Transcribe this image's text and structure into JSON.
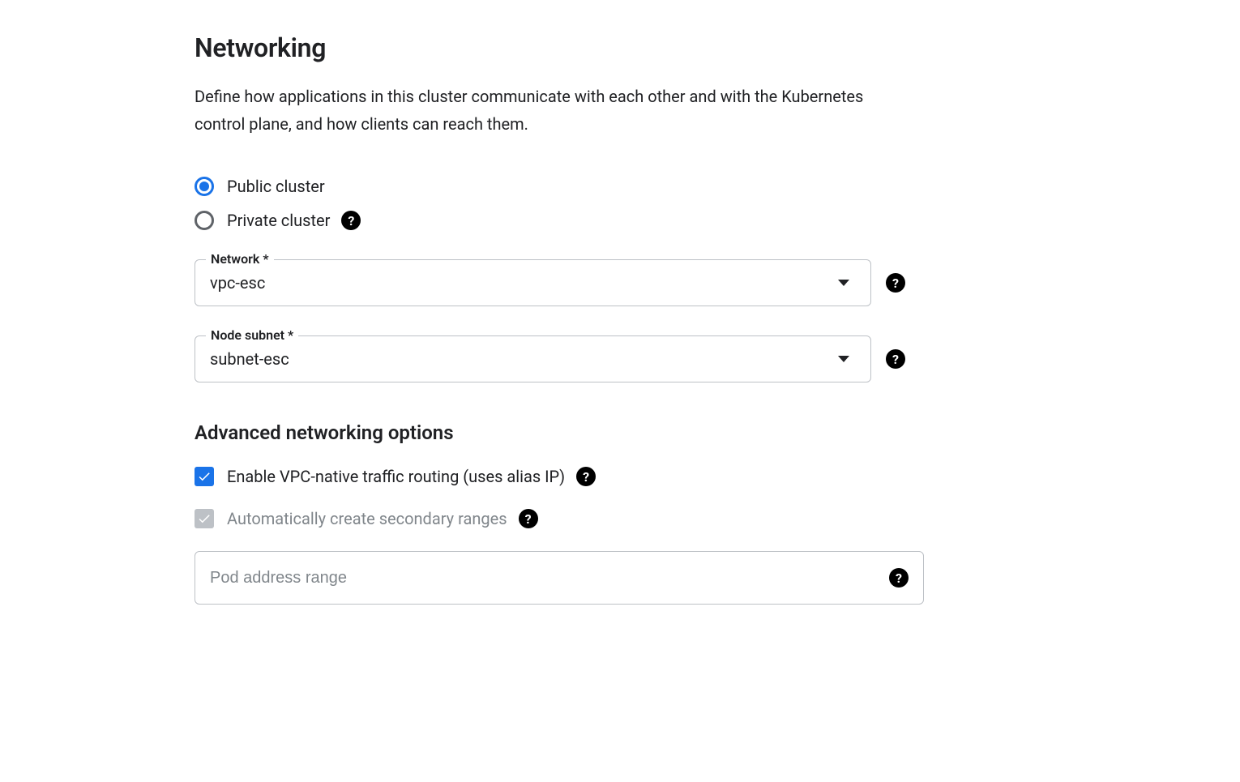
{
  "title": "Networking",
  "description": "Define how applications in this cluster communicate with each other and with the Kubernetes control plane, and how clients can reach them.",
  "radio": {
    "public_label": "Public cluster",
    "private_label": "Private cluster"
  },
  "network": {
    "label": "Network *",
    "value": "vpc-esc"
  },
  "node_subnet": {
    "label": "Node subnet *",
    "value": "subnet-esc"
  },
  "advanced_heading": "Advanced networking options",
  "vpc_native": {
    "label": "Enable VPC-native traffic routing (uses alias IP)"
  },
  "auto_secondary": {
    "label": "Automatically create secondary ranges"
  },
  "pod_range": {
    "placeholder": "Pod address range"
  }
}
